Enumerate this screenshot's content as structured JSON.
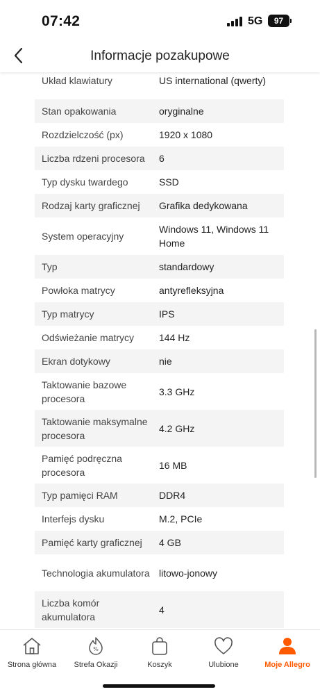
{
  "status_bar": {
    "time": "07:42",
    "network": "5G",
    "battery": "97"
  },
  "header": {
    "title": "Informacje pozakupowe",
    "back_icon": "chevron-left-icon"
  },
  "specs": [
    {
      "label": "Układ klawiatury",
      "value": "US international (qwerty)"
    },
    {
      "label": "Stan opakowania",
      "value": "oryginalne"
    },
    {
      "label": "Rozdzielczość (px)",
      "value": "1920 x 1080"
    },
    {
      "label": "Liczba rdzeni procesora",
      "value": "6"
    },
    {
      "label": "Typ dysku twardego",
      "value": "SSD"
    },
    {
      "label": "Rodzaj karty graficznej",
      "value": "Grafika dedykowana"
    },
    {
      "label": "System operacyjny",
      "value": "Windows 11, Windows 11 Home"
    },
    {
      "label": "Typ",
      "value": "standardowy"
    },
    {
      "label": "Powłoka matrycy",
      "value": "antyrefleksyjna"
    },
    {
      "label": "Typ matrycy",
      "value": "IPS"
    },
    {
      "label": "Odświeżanie matrycy",
      "value": "144 Hz"
    },
    {
      "label": "Ekran dotykowy",
      "value": "nie"
    },
    {
      "label": "Taktowanie bazowe procesora",
      "value": "3.3 GHz"
    },
    {
      "label": "Taktowanie maksymalne procesora",
      "value": "4.2 GHz"
    },
    {
      "label": "Pamięć podręczna procesora",
      "value": "16 MB"
    },
    {
      "label": "Typ pamięci RAM",
      "value": "DDR4"
    },
    {
      "label": "Interfejs dysku",
      "value": "M.2, PCIe"
    },
    {
      "label": "Pamięć karty graficznej",
      "value": "4 GB"
    },
    {
      "label": "Technologia akumulatora",
      "value": "litowo-jonowy"
    },
    {
      "label": "Liczba komór akumulatora",
      "value": "4"
    }
  ],
  "bottom_nav": {
    "items": [
      {
        "label": "Strona główna",
        "icon": "home-icon",
        "active": false
      },
      {
        "label": "Strefa Okazji",
        "icon": "deals-percent-icon",
        "active": false
      },
      {
        "label": "Koszyk",
        "icon": "shopping-bag-icon",
        "active": false
      },
      {
        "label": "Ulubione",
        "icon": "heart-icon",
        "active": false
      },
      {
        "label": "Moje Allegro",
        "icon": "user-icon",
        "active": true
      }
    ]
  },
  "colors": {
    "accent": "#ff5a00",
    "row_alt": "#f4f4f4",
    "text": "#222222"
  }
}
